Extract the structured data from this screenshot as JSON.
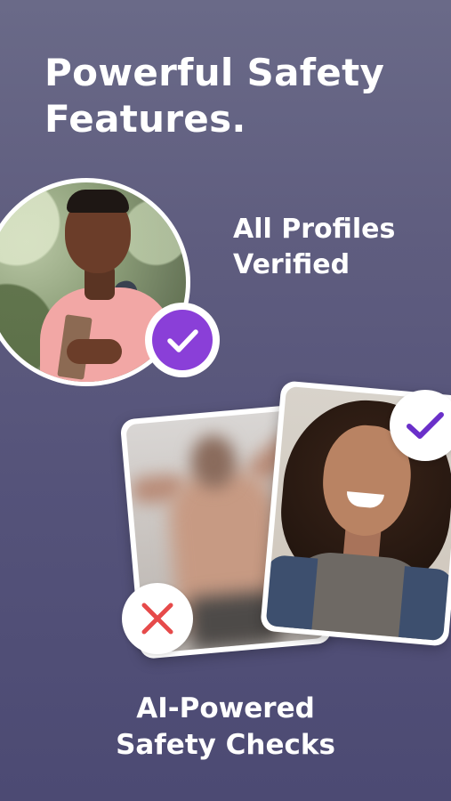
{
  "headline": {
    "line1": "Powerful Safety",
    "line2": "Features."
  },
  "verified_feature": {
    "line1": "All Profiles",
    "line2": "Verified"
  },
  "ai_feature": {
    "line1": "AI-Powered",
    "line2": "Safety Checks"
  },
  "icons": {
    "verified_badge": "checkmark-icon",
    "approved_badge": "checkmark-icon",
    "rejected_badge": "cross-icon"
  },
  "colors": {
    "background_top": "#6a6a88",
    "background_bottom": "#4c4a73",
    "verified_badge": "#8a3fd8",
    "check_mark": "#6a2fc9",
    "cross_mark": "#e64a4a",
    "text": "#ffffff"
  }
}
